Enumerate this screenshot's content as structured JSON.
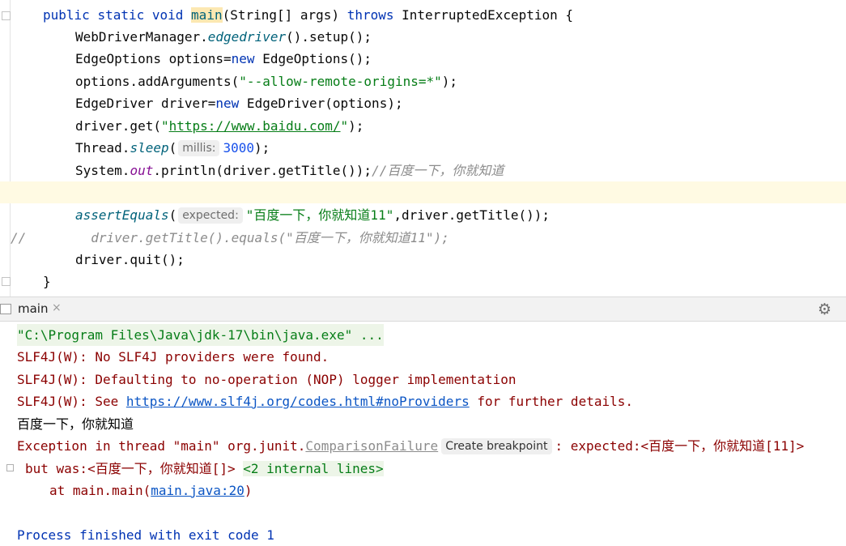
{
  "editor": {
    "line1": {
      "kw1": "public",
      "kw2": "static",
      "kw3": "void",
      "name": "main",
      "params": "(String[] args) ",
      "kw4": "throws",
      "rest": " InterruptedException {"
    },
    "line2": {
      "a": "WebDriverManager.",
      "m": "edgedriver",
      "b": "().setup();"
    },
    "line3": {
      "a": "EdgeOptions options=",
      "kw": "new",
      "b": " EdgeOptions();"
    },
    "line4": {
      "a": "options.addArguments(",
      "s": "\"--allow-remote-origins=*\"",
      "b": ");"
    },
    "line5": {
      "a": "EdgeDriver driver=",
      "kw": "new",
      "b": " EdgeDriver(options);"
    },
    "line6": {
      "a": "driver.get(",
      "q1": "\"",
      "url": "https://www.baidu.com/",
      "q2": "\"",
      "b": ");"
    },
    "line7": {
      "a": "Thread.",
      "m": "sleep",
      "p": "(",
      "hint": "millis:",
      "n": "3000",
      "b": ");"
    },
    "line8": {
      "a": "System.",
      "f": "out",
      "b": ".println(driver.getTitle());",
      "c": "//百度一下，你就知道"
    },
    "line10": {
      "m": "assertEquals",
      "p": "(",
      "hint": "expected:",
      "s": "\"百度一下，你就知道11\"",
      "b": ",driver.getTitle());"
    },
    "line11": {
      "c1": "//",
      "c2": "driver.getTitle().equals(\"百度一下，你就知道11\");"
    },
    "line12": {
      "a": "driver.quit();"
    },
    "line13": {
      "a": "}"
    }
  },
  "run_panel": {
    "tab_label": "main",
    "close_glyph": "×",
    "settings_glyph": "⚙"
  },
  "console": {
    "cmd": "\"C:\\Program Files\\Java\\jdk-17\\bin\\java.exe\" ...",
    "slf1": "SLF4J(W): No SLF4J providers were found.",
    "slf2": "SLF4J(W): Defaulting to no-operation (NOP) logger implementation",
    "slf3a": "SLF4J(W): See ",
    "slf3link": "https://www.slf4j.org/codes.html#noProviders",
    "slf3b": " for further details.",
    "title_out": "百度一下，你就知道",
    "exc_a": "Exception in thread \"main\" org.junit.",
    "exc_link": "ComparisonFailure",
    "exc_bp": "Create breakpoint",
    "exc_b": ": expected:<百度一下，你就知道[11]>",
    "but": "but was:<百度一下，你就知道[]>",
    "internal": "<2 internal lines>",
    "at_a": "at main.main(",
    "at_link": "main.java:20",
    "at_b": ")",
    "exit": "Process finished with exit code 1"
  },
  "colors": {
    "keyword": "#0033b3",
    "string": "#067d17",
    "error": "#8b0000",
    "link": "#0b55c4"
  }
}
